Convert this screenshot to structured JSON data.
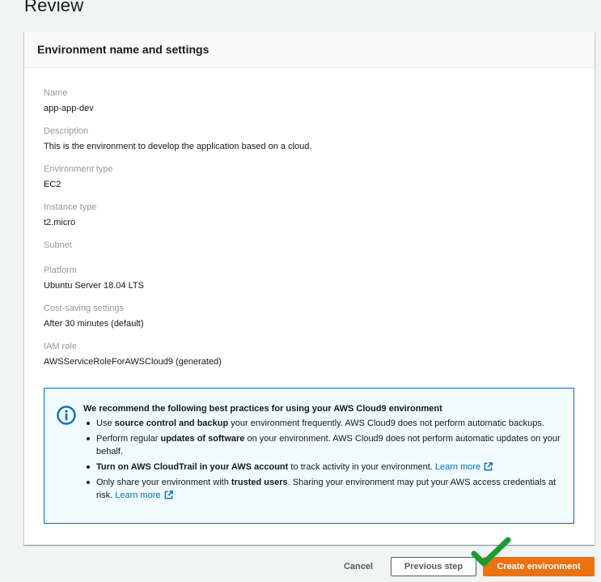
{
  "page": {
    "title": "Review"
  },
  "panel": {
    "header": "Environment name and settings",
    "fields": [
      {
        "label": "Name",
        "value": "app-app-dev"
      },
      {
        "label": "Description",
        "value": "This is the environment to develop the application based on a cloud."
      },
      {
        "label": "Environment type",
        "value": "EC2"
      },
      {
        "label": "Instance type",
        "value": "t2.micro"
      },
      {
        "label": "Subnet",
        "value": ""
      },
      {
        "label": "Platform",
        "value": "Ubuntu Server 18.04 LTS"
      },
      {
        "label": "Cost-saving settings",
        "value": "After 30 minutes (default)"
      },
      {
        "label": "IAM role",
        "value": "AWSServiceRoleForAWSCloud9 (generated)"
      }
    ]
  },
  "alert": {
    "icon": "info-icon",
    "title": "We recommend the following best practices for using your AWS Cloud9 environment",
    "items": [
      {
        "pre": "Use ",
        "bold": "source control and backup",
        "post": " your environment frequently. AWS Cloud9 does not perform automatic backups.",
        "link": ""
      },
      {
        "pre": "Perform regular ",
        "bold": "updates of software",
        "post": " on your environment. AWS Cloud9 does not perform automatic updates on your behalf.",
        "link": ""
      },
      {
        "pre": "",
        "bold": "Turn on AWS CloudTrail in your AWS account",
        "post": " to track activity in your environment. ",
        "link": "Learn more"
      },
      {
        "pre": "Only share your environment with ",
        "bold": "trusted users",
        "post": ". Sharing your environment may put your AWS access credentials at risk. ",
        "link": "Learn more"
      }
    ]
  },
  "footer": {
    "cancel": "Cancel",
    "previous": "Previous step",
    "create": "Create environment"
  },
  "colors": {
    "accent": "#ec7211",
    "link": "#0073bb",
    "checkmark": "#1a9c2e"
  }
}
